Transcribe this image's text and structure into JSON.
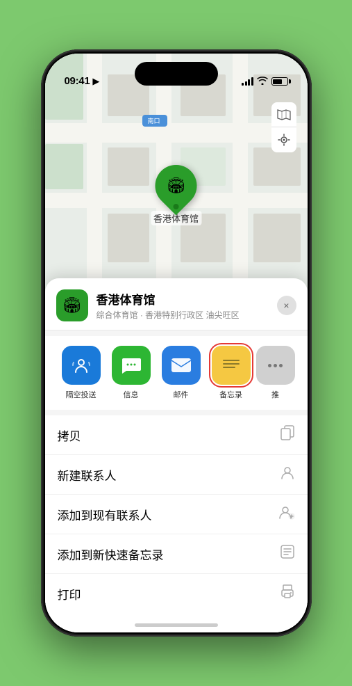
{
  "status_bar": {
    "time": "09:41",
    "location_arrow": "▶"
  },
  "map": {
    "label_south_entrance": "南口",
    "venue_pin_label": "香港体育馆",
    "map_type_icon": "🗺",
    "location_icon": "➤"
  },
  "venue_header": {
    "name": "香港体育馆",
    "description": "综合体育馆 · 香港特别行政区 油尖旺区",
    "close_label": "×"
  },
  "share_items": [
    {
      "id": "airdrop",
      "label": "隔空投送",
      "icon": "📶"
    },
    {
      "id": "messages",
      "label": "信息",
      "icon": "💬"
    },
    {
      "id": "mail",
      "label": "邮件",
      "icon": "✉"
    },
    {
      "id": "notes",
      "label": "备忘录",
      "icon": "📋"
    },
    {
      "id": "more",
      "label": "推",
      "icon": "···"
    }
  ],
  "actions": [
    {
      "id": "copy",
      "label": "拷贝",
      "icon": "⎘"
    },
    {
      "id": "new-contact",
      "label": "新建联系人",
      "icon": "👤"
    },
    {
      "id": "add-to-contact",
      "label": "添加到现有联系人",
      "icon": "👤+"
    },
    {
      "id": "add-to-notes",
      "label": "添加到新快速备忘录",
      "icon": "📝"
    },
    {
      "id": "print",
      "label": "打印",
      "icon": "🖨"
    }
  ]
}
